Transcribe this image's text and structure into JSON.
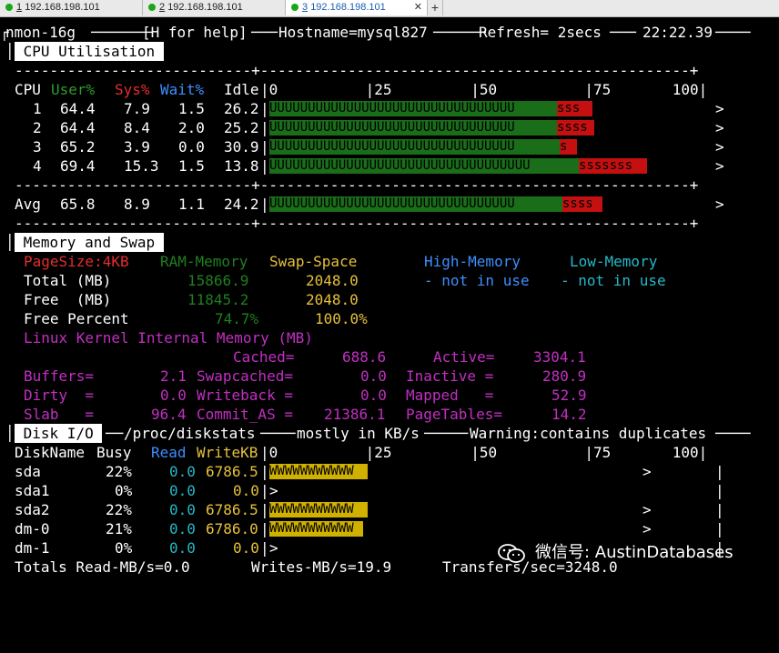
{
  "tabs": [
    {
      "num": "1",
      "host": "192.168.198.101",
      "active": false
    },
    {
      "num": "2",
      "host": "192.168.198.101",
      "active": false
    },
    {
      "num": "3",
      "host": "192.168.198.101",
      "active": true
    }
  ],
  "header": {
    "app": "nmon-16g",
    "help": "[H for help]",
    "hostname": "Hostname=mysql827",
    "refresh": "Refresh= 2secs",
    "time": "22:22.39"
  },
  "cpu": {
    "title": "CPU Utilisation",
    "dash_line": "---------------------------+-------------------------------------------------+",
    "col_cpu": "CPU",
    "col_user": "User%",
    "col_sys": "Sys%",
    "col_wait": "Wait%",
    "col_idle": "Idle",
    "scale": "|0          |25         |50          |75       100|",
    "rows": [
      {
        "cpu": "1",
        "user": "64.4",
        "sys": "7.9",
        "wait": "1.5",
        "idle": "26.2",
        "user_bar": "UUUUUUUUUUUUUUUUUUUUUUUUUUUUUUUU",
        "sys_bar": "sss",
        "user_pct": 64.4,
        "sys_pct": 7.9
      },
      {
        "cpu": "2",
        "user": "64.4",
        "sys": "8.4",
        "wait": "2.0",
        "idle": "25.2",
        "user_bar": "UUUUUUUUUUUUUUUUUUUUUUUUUUUUUUUU",
        "sys_bar": "ssss",
        "user_pct": 64.4,
        "sys_pct": 8.4
      },
      {
        "cpu": "3",
        "user": "65.2",
        "sys": "3.9",
        "wait": "0.0",
        "idle": "30.9",
        "user_bar": "UUUUUUUUUUUUUUUUUUUUUUUUUUUUUUUU",
        "sys_bar": "s",
        "user_pct": 65.2,
        "sys_pct": 3.9
      },
      {
        "cpu": "4",
        "user": "69.4",
        "sys": "15.3",
        "wait": "1.5",
        "idle": "13.8",
        "user_bar": "UUUUUUUUUUUUUUUUUUUUUUUUUUUUUUUUUU",
        "sys_bar": "sssssss",
        "user_pct": 69.4,
        "sys_pct": 15.3
      }
    ],
    "avg": {
      "cpu": "Avg",
      "user": "65.8",
      "sys": "8.9",
      "wait": "1.1",
      "idle": "24.2",
      "user_bar": "UUUUUUUUUUUUUUUUUUUUUUUUUUUUUUUU",
      "sys_bar": "ssss",
      "user_pct": 65.8,
      "sys_pct": 8.9
    },
    "end_marker": ">"
  },
  "memory": {
    "title": "Memory and Swap",
    "pagesize": "PageSize:4KB",
    "ram_label": "RAM-Memory",
    "swap_label": "Swap-Space",
    "high_label": "High-Memory",
    "low_label": "Low-Memory",
    "total_label": "Total (MB)",
    "total_ram": "15866.9",
    "total_swap": "2048.0",
    "high_status": "- not in use",
    "low_status": "- not in use",
    "free_label": "Free  (MB)",
    "free_ram": "11845.2",
    "free_swap": "2048.0",
    "freepct_label": "Free Percent",
    "freepct_ram": "74.7%",
    "freepct_swap": "100.0%",
    "kernel_title": "Linux Kernel Internal Memory (MB)",
    "cached_label": "Cached=",
    "cached_val": "688.6",
    "active_label": "Active=",
    "active_val": "3304.1",
    "buffers_label": "Buffers=",
    "buffers_val": "2.1",
    "swapcached_label": "Swapcached=",
    "swapcached_val": "0.0",
    "inactive_label": "Inactive =",
    "inactive_val": "280.9",
    "dirty_label": "Dirty  =",
    "dirty_val": "0.0",
    "writeback_label": "Writeback =",
    "writeback_val": "0.0",
    "mapped_label": "Mapped   =",
    "mapped_val": "52.9",
    "slab_label": "Slab   =",
    "slab_val": "96.4",
    "commitas_label": "Commit_AS =",
    "commitas_val": "21386.1",
    "pagetables_label": "PageTables=",
    "pagetables_val": "14.2"
  },
  "disk": {
    "title": "Disk I/O",
    "source": "/proc/diskstats",
    "units": "mostly in KB/s",
    "warning": "Warning:contains duplicates",
    "col_name": "DiskName",
    "col_busy": "Busy",
    "col_read": "Read",
    "col_write": "WriteKB",
    "scale": "|0          |25         |50          |75       100|",
    "rows": [
      {
        "name": "sda",
        "busy": "22%",
        "read": "0.0",
        "write": "6786.5",
        "bar": "WWWWWWWWWWW",
        "busy_pct": 22,
        "marker": ">"
      },
      {
        "name": "sda1",
        "busy": "0%",
        "read": "0.0",
        "write": "0.0",
        "bar": "",
        "busy_pct": 0,
        "marker": ""
      },
      {
        "name": "sda2",
        "busy": "22%",
        "read": "0.0",
        "write": "6786.5",
        "bar": "WWWWWWWWWWW",
        "busy_pct": 22,
        "marker": ">"
      },
      {
        "name": "dm-0",
        "busy": "21%",
        "read": "0.0",
        "write": "6786.0",
        "bar": "WWWWWWWWWWW",
        "busy_pct": 21,
        "marker": ">"
      },
      {
        "name": "dm-1",
        "busy": "0%",
        "read": "0.0",
        "write": "0.0",
        "bar": "",
        "busy_pct": 0,
        "marker": ""
      }
    ],
    "totals_read": "Totals Read-MB/s=0.0",
    "totals_write": "Writes-MB/s=19.9",
    "totals_xfer": "Transfers/sec=3248.0"
  },
  "watermark": {
    "text": "微信号: AustinDatabases",
    "icon": "wechat-icon"
  }
}
